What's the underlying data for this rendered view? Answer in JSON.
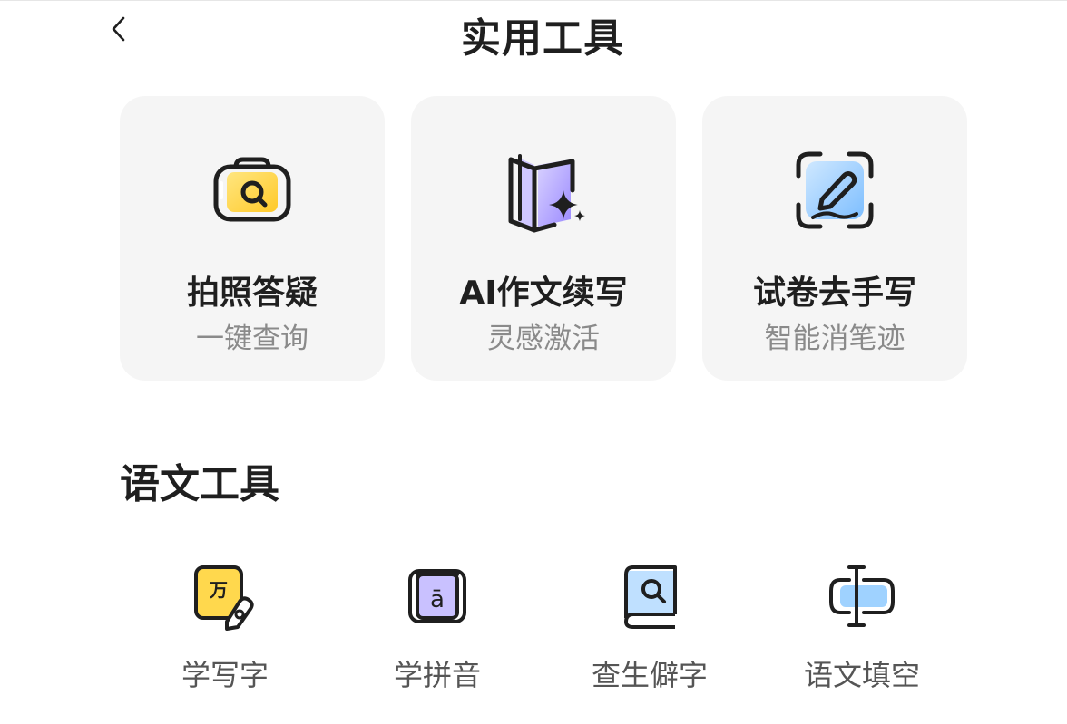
{
  "header": {
    "title": "实用工具",
    "back_icon": "chevron-left-icon"
  },
  "feature_cards": [
    {
      "title": "拍照答疑",
      "subtitle": "一键查询",
      "icon": "camera-search-icon"
    },
    {
      "title": "AI作文续写",
      "subtitle": "灵感激活",
      "icon": "ai-book-sparkle-icon"
    },
    {
      "title": "试卷去手写",
      "subtitle": "智能消笔迹",
      "icon": "scan-pen-icon"
    }
  ],
  "section": {
    "title": "语文工具"
  },
  "tools": [
    {
      "label": "学写字",
      "icon": "write-character-icon",
      "badge": "万"
    },
    {
      "label": "学拼音",
      "icon": "pinyin-book-icon",
      "badge": "ā"
    },
    {
      "label": "查生僻字",
      "icon": "dictionary-search-icon"
    },
    {
      "label": "语文填空",
      "icon": "text-cursor-fill-icon"
    }
  ],
  "colors": {
    "yellow": "#FFD84D",
    "purple": "#A99BFF",
    "blue": "#8CC8FF",
    "ink": "#1F1F1F",
    "card_bg": "#F5F5F5",
    "muted_text": "#8A8A8A"
  }
}
